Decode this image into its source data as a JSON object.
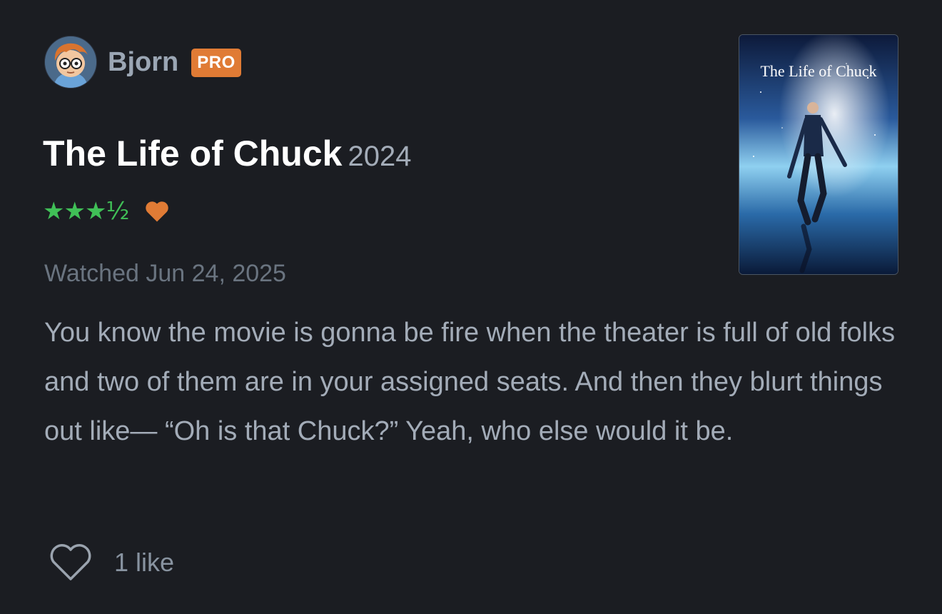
{
  "user": {
    "name": "Bjorn",
    "badge": "PRO"
  },
  "film": {
    "title": "The Life of Chuck",
    "year": "2024",
    "rating_display": "★★★½",
    "rating_value": 3.5,
    "liked": true,
    "poster_title": "The Life of Chuck"
  },
  "review": {
    "watched": "Watched Jun 24, 2025",
    "text": "You know the movie is gonna be fire when the theater is full of old folks and two of them are in your assigned seats. And then they blurt things out like— “Oh is that Chuck?” Yeah, who else would it be."
  },
  "likes": {
    "count_label": "1 like"
  },
  "icons": {
    "liked_heart": "heart-icon",
    "like_outline": "heart-outline-icon"
  },
  "colors": {
    "background": "#1b1d22",
    "pro_badge": "#e07b35",
    "stars": "#40c057",
    "heart": "#e07b35",
    "muted_text": "#a3acb8"
  }
}
